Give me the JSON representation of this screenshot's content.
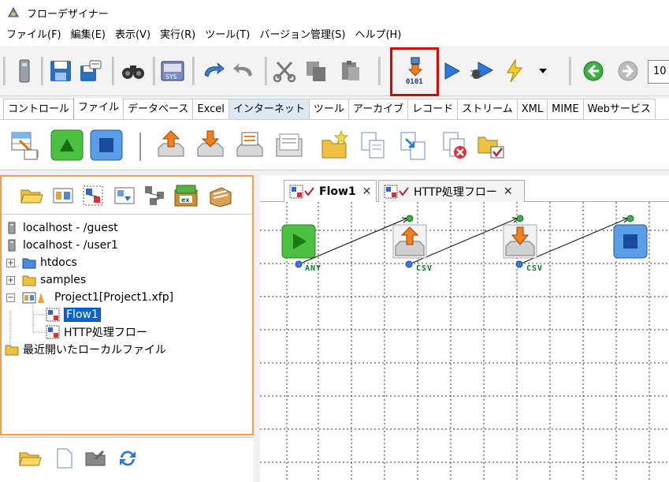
{
  "window": {
    "title": "フローデザイナー"
  },
  "menu": [
    "ファイル(F)",
    "編集(E)",
    "表示(V)",
    "実行(R)",
    "ツール(T)",
    "バージョン管理(S)",
    "ヘルプ(H)"
  ],
  "toolbar": {
    "zoom_value": "10",
    "icons": [
      "usb-drive-icon",
      "save-icon",
      "save-as-icon",
      "binoculars-icon",
      "sys-icon",
      "undo-icon",
      "redo-icon",
      "cut-icon",
      "copy-icon",
      "paste-icon",
      "compile-icon",
      "run-icon",
      "debug-run-icon",
      "lightning-icon",
      "dropdown-arrow-icon",
      "back-icon",
      "forward-icon"
    ]
  },
  "category_tabs": [
    "コントロール",
    "ファイル",
    "データベース",
    "Excel",
    "インターネット",
    "ツール",
    "アーカイブ",
    "レコード",
    "ストリーム",
    "XML",
    "MIME",
    "Webサービス"
  ],
  "active_category": "ファイル",
  "tree": {
    "items": [
      {
        "label": "localhost - /guest"
      },
      {
        "label": "localhost - /user1"
      },
      {
        "label": "htdocs"
      },
      {
        "label": "samples"
      },
      {
        "label": "Project1[Project1.xfp]"
      },
      {
        "label": "Flow1"
      },
      {
        "label": "HTTP処理フロー"
      },
      {
        "label": "最近開いたローカルファイル"
      }
    ]
  },
  "canvas_tabs": [
    {
      "label": "Flow1"
    },
    {
      "label": "HTTP処理フロー"
    }
  ],
  "close_glyph": "✕",
  "flow": {
    "ports": [
      "ANY",
      "CSV",
      "CSV"
    ]
  },
  "colors": {
    "highlight": "#e00000",
    "selection": "#0a64d0",
    "panel_border": "#f0a050"
  }
}
